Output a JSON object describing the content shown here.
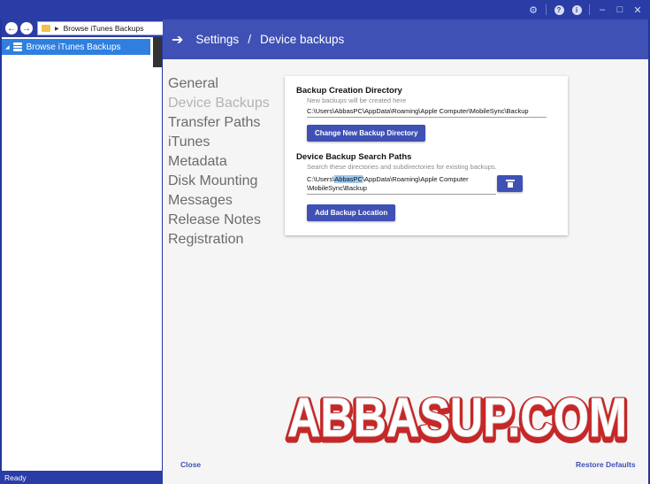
{
  "nav": {
    "address": "Browse iTunes Backups"
  },
  "tree": {
    "selected_label": "Browse iTunes Backups"
  },
  "status": {
    "text": "Ready"
  },
  "header": {
    "settings": "Settings",
    "separator": "/",
    "page": "Device backups"
  },
  "menu": {
    "items": [
      {
        "label": "General"
      },
      {
        "label": "Device Backups"
      },
      {
        "label": "Transfer Paths"
      },
      {
        "label": "iTunes"
      },
      {
        "label": "Metadata"
      },
      {
        "label": "Disk Mounting"
      },
      {
        "label": "Messages"
      },
      {
        "label": "Release Notes"
      },
      {
        "label": "Registration"
      }
    ],
    "active_index": 1
  },
  "backup_creation": {
    "title": "Backup Creation Directory",
    "subtitle": "New backups will be created here",
    "path": "C:\\Users\\AbbasPC\\AppData\\Roaming\\Apple Computer\\MobileSync\\Backup",
    "button": "Change New Backup Directory"
  },
  "search_paths": {
    "title": "Device Backup Search Paths",
    "subtitle": "Search these directories and subdirectories for existing backups.",
    "path_prefix": "C:\\Users\\",
    "path_highlight": "AbbasPC",
    "path_rest_line1": "\\AppData\\Roaming\\Apple Computer",
    "path_line2": "\\MobileSync\\Backup",
    "add_button": "Add Backup Location"
  },
  "footer": {
    "close": "Close",
    "restore": "Restore Defaults"
  },
  "watermark": {
    "text": "ABBASUP.COM"
  },
  "colors": {
    "accent": "#3f51b5",
    "window": "#23369e",
    "selection": "#2f7fe0",
    "watermark_fill": "#ffffff",
    "watermark_stroke": "#c62828"
  }
}
